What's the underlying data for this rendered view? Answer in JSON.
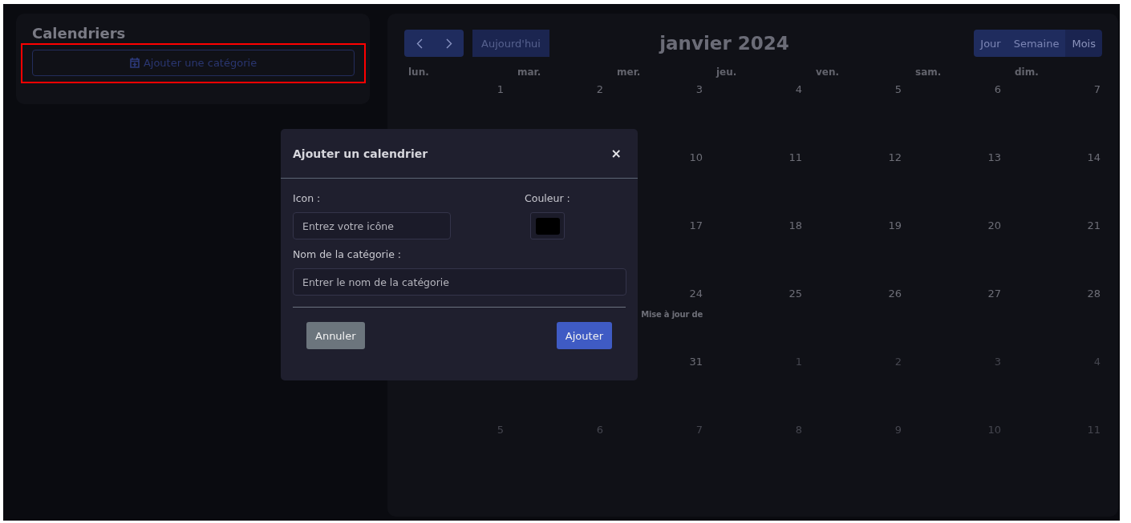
{
  "sidebar": {
    "title": "Calendriers",
    "add_button": {
      "label": "Ajouter une catégorie",
      "highlighted": true
    }
  },
  "calendar": {
    "nav": [
      {
        "kind": "prev"
      },
      {
        "kind": "next"
      }
    ],
    "today_button": "Aujourd'hui",
    "title": "janvier 2024",
    "views": [
      {
        "label": "Jour",
        "selected": false
      },
      {
        "label": "Semaine",
        "selected": false
      },
      {
        "label": "Mois",
        "selected": true
      }
    ],
    "weekdays": [
      "lun.",
      "mar.",
      "mer.",
      "jeu.",
      "ven.",
      "sam.",
      "dim."
    ],
    "weeks": [
      [
        {
          "day": "1",
          "muted": false
        },
        {
          "day": "2",
          "muted": false
        },
        {
          "day": "3",
          "muted": false
        },
        {
          "day": "4",
          "muted": false
        },
        {
          "day": "5",
          "muted": false
        },
        {
          "day": "6",
          "muted": false
        },
        {
          "day": "7",
          "muted": false
        }
      ],
      [
        {
          "day": "10",
          "muted": false
        },
        {
          "day": "11",
          "muted": false
        },
        {
          "day": "12",
          "muted": false
        },
        {
          "day": "13",
          "muted": false
        },
        {
          "day": "14",
          "muted": false
        }
      ],
      [
        {
          "day": "17",
          "muted": false
        },
        {
          "day": "18",
          "muted": false
        },
        {
          "day": "19",
          "muted": false
        },
        {
          "day": "20",
          "muted": false
        },
        {
          "day": "21",
          "muted": false
        }
      ],
      [
        {
          "day": "24",
          "muted": false,
          "event": "Mise à jour de"
        },
        {
          "day": "25",
          "muted": false
        },
        {
          "day": "26",
          "muted": false
        },
        {
          "day": "27",
          "muted": false
        },
        {
          "day": "28",
          "muted": false
        }
      ],
      [
        {
          "day": "31",
          "muted": false
        },
        {
          "day": "1",
          "muted": true
        },
        {
          "day": "2",
          "muted": true
        },
        {
          "day": "3",
          "muted": true
        },
        {
          "day": "4",
          "muted": true
        }
      ],
      [
        {
          "day": "5",
          "muted": true
        },
        {
          "day": "6",
          "muted": true
        },
        {
          "day": "7",
          "muted": true
        },
        {
          "day": "8",
          "muted": true
        },
        {
          "day": "9",
          "muted": true
        },
        {
          "day": "10",
          "muted": true
        },
        {
          "day": "11",
          "muted": true
        }
      ]
    ]
  },
  "dialog": {
    "title": "Ajouter un calendrier",
    "close": "×",
    "icon_label": "Icon :",
    "icon_placeholder": "Entrez votre icône",
    "color_label": "Couleur :",
    "color": "#000000",
    "name_label": "Nom de la catégorie :",
    "name_placeholder": "Entrer le nom de la catégorie",
    "cancel": "Annuler",
    "submit": "Ajouter"
  }
}
